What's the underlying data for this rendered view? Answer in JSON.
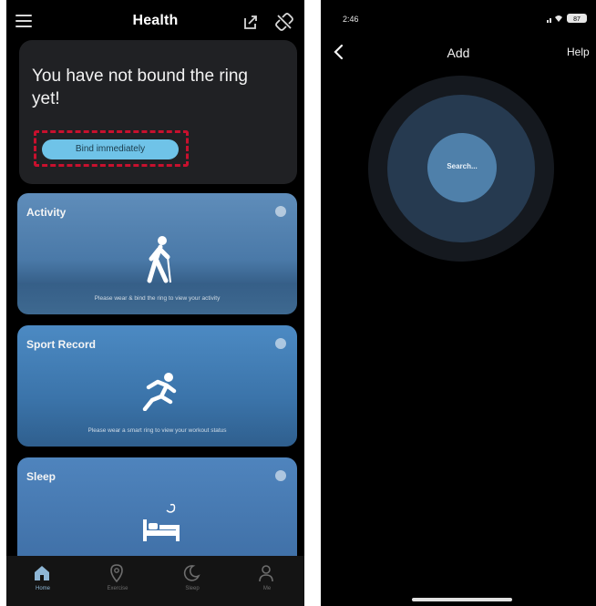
{
  "left": {
    "header": {
      "title": "Health"
    },
    "bind_card": {
      "message": "You have not bound the ring yet!",
      "button_label": "Bind immediately"
    },
    "cards": [
      {
        "label": "Activity",
        "subtitle": "Please wear & bind the ring to view your activity"
      },
      {
        "label": "Sport Record",
        "subtitle": "Please wear a smart ring to view your workout status"
      },
      {
        "label": "Sleep",
        "subtitle": ""
      }
    ],
    "tabs": [
      {
        "label": "Home",
        "icon": "home-icon",
        "active": true
      },
      {
        "label": "Exercise",
        "icon": "location-pin-icon",
        "active": false
      },
      {
        "label": "Sleep",
        "icon": "moon-icon",
        "active": false
      },
      {
        "label": "Me",
        "icon": "person-icon",
        "active": false
      }
    ]
  },
  "right": {
    "status_time": "2:46",
    "battery": "87",
    "title": "Add",
    "help": "Help",
    "search_label": "Search..."
  },
  "colors": {
    "accent": "#6fc3e8",
    "highlight_border": "#c8102e",
    "card_blue": "#4a79a8",
    "ring_inner": "#4f80aa"
  }
}
